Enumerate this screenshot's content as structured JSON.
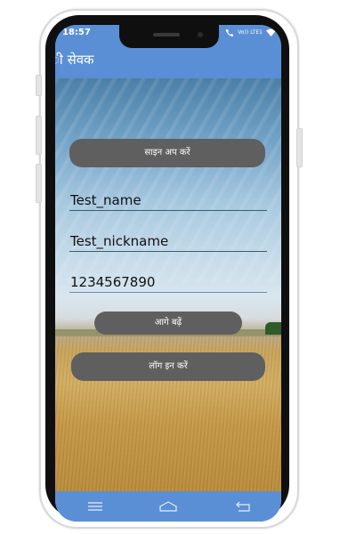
{
  "status_bar": {
    "time": "18:57",
    "network_label": "Vo)) LTE1",
    "icons": [
      "signal-icon",
      "phone-icon",
      "wifi-icon"
    ]
  },
  "app_bar": {
    "title": "ी सेवक"
  },
  "form": {
    "signup_label": "साइन अप करें",
    "name_value": "Test_name",
    "nickname_value": "Test_nickname",
    "phone_value": "1234567890",
    "next_label": "आगे बढ़ें",
    "login_label": "लॉग इन करें"
  },
  "nav_bar": {
    "icons": [
      "menu-icon",
      "home-icon",
      "back-icon"
    ]
  },
  "colors": {
    "app_bar": "#5a8fd6",
    "button": "#5f5f5f",
    "text_on_button": "#ffffff"
  }
}
